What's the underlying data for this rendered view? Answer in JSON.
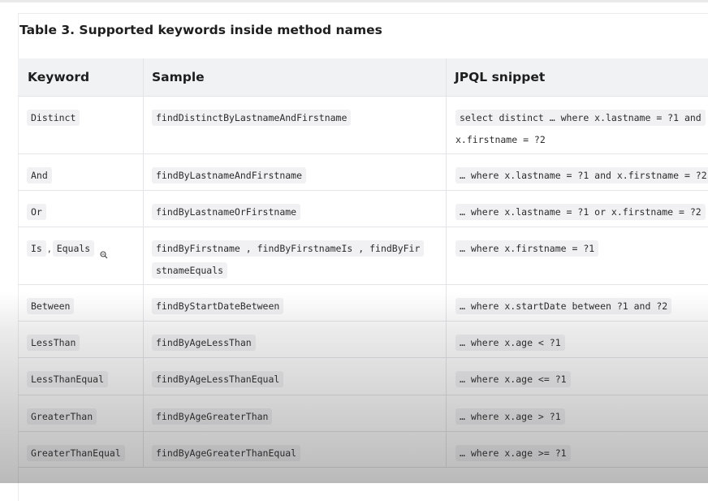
{
  "caption": "Table 3. Supported keywords inside method names",
  "headers": {
    "keyword": "Keyword",
    "sample": "Sample",
    "jpql": "JPQL snippet"
  },
  "rows": [
    {
      "keywords": [
        "Distinct"
      ],
      "samples": [
        "findDistinctByLastnameAndFirstname"
      ],
      "jpql_lines": [
        "select distinct … where x.lastname = ?1 and",
        "x.firstname = ?2"
      ]
    },
    {
      "keywords": [
        "And"
      ],
      "samples": [
        "findByLastnameAndFirstname"
      ],
      "jpql_lines": [
        "… where x.lastname = ?1 and x.firstname = ?2"
      ]
    },
    {
      "keywords": [
        "Or"
      ],
      "samples": [
        "findByLastnameOrFirstname"
      ],
      "jpql_lines": [
        "… where x.lastname = ?1 or x.firstname = ?2"
      ]
    },
    {
      "keywords": [
        "Is",
        "Equals"
      ],
      "separator": ",",
      "samples_lines": [
        "findByFirstname , findByFirstnameIs , findByFir",
        "stnameEquals"
      ],
      "jpql_lines": [
        "… where x.firstname = ?1"
      ]
    },
    {
      "keywords": [
        "Between"
      ],
      "samples": [
        "findByStartDateBetween"
      ],
      "jpql_lines": [
        "… where x.startDate between ?1 and ?2"
      ]
    },
    {
      "keywords": [
        "LessThan"
      ],
      "samples": [
        "findByAgeLessThan"
      ],
      "jpql_lines": [
        "… where x.age < ?1"
      ]
    },
    {
      "keywords": [
        "LessThanEqual"
      ],
      "samples": [
        "findByAgeLessThanEqual"
      ],
      "jpql_lines": [
        "… where x.age <= ?1"
      ]
    },
    {
      "keywords": [
        "GreaterThan"
      ],
      "samples": [
        "findByAgeGreaterThan"
      ],
      "jpql_lines": [
        "… where x.age > ?1"
      ]
    },
    {
      "keywords": [
        "GreaterThanEqual"
      ],
      "samples": [
        "findByAgeGreaterThanEqual"
      ],
      "jpql_lines": [
        "… where x.age >= ?1"
      ]
    }
  ],
  "cursor_icon": "zoom-cursor-icon"
}
